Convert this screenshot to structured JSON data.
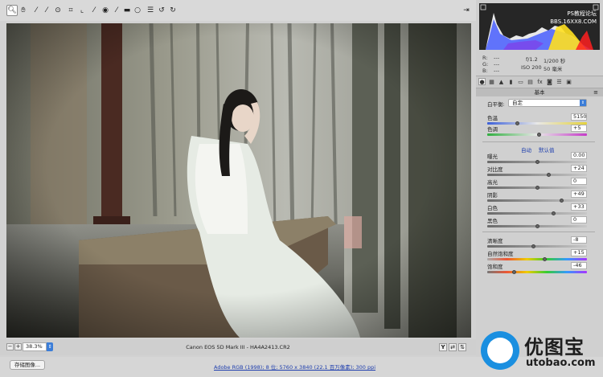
{
  "toolbar": {
    "tools": [
      {
        "name": "zoom-icon",
        "glyph": "🔍︎"
      },
      {
        "name": "hand-icon",
        "glyph": "✋︎"
      },
      {
        "name": "white-balance-icon",
        "glyph": "⁄"
      },
      {
        "name": "color-sampler-icon",
        "glyph": "⁄"
      },
      {
        "name": "target-adjust-icon",
        "glyph": "⊙"
      },
      {
        "name": "crop-icon",
        "glyph": "⌗"
      },
      {
        "name": "straighten-icon",
        "glyph": "⌞"
      },
      {
        "name": "spot-removal-icon",
        "glyph": "⁄"
      },
      {
        "name": "red-eye-icon",
        "glyph": "◉"
      },
      {
        "name": "adjustment-brush-icon",
        "glyph": "⁄"
      },
      {
        "name": "graduated-filter-icon",
        "glyph": "▬"
      },
      {
        "name": "radial-filter-icon",
        "glyph": "○"
      },
      {
        "name": "preferences-icon",
        "glyph": "☰"
      },
      {
        "name": "rotate-ccw-icon",
        "glyph": "↺"
      },
      {
        "name": "rotate-cw-icon",
        "glyph": "↻"
      }
    ],
    "export_glyph": "⇥"
  },
  "zoom": {
    "minus": "−",
    "plus": "+",
    "value": "38.3%",
    "arrow": "⇕"
  },
  "filename": "Canon EOS 5D Mark III -   HA4A2413.CR2",
  "statusbar": {
    "save_label": "存储图像...",
    "workflow": "Adobe RGB (1998); 8 位;   5760 x 3840 (22.1 百万像素); 300 ppi"
  },
  "histogram": {
    "watermark_line1": "PS教程论坛",
    "watermark_line2": "BBS.16XX8.COM"
  },
  "info": {
    "r_label": "R:",
    "g_label": "G:",
    "b_label": "B:",
    "r_value": "---",
    "g_value": "---",
    "b_value": "---",
    "aperture": "f/1.2",
    "shutter": "1/200 秒",
    "iso": "ISO 200",
    "focal": "50 毫米"
  },
  "panel": {
    "section_title": "基本",
    "section_menu": "≡",
    "wb_label": "白平衡:",
    "wb_value": "自定",
    "auto_label": "自动",
    "default_label": "默认值",
    "sliders": [
      {
        "name": "temperature",
        "label": "色温",
        "value": "5150",
        "fraction": 0.3
      },
      {
        "name": "tint",
        "label": "色调",
        "value": "+5",
        "fraction": 0.52
      },
      {
        "name": "exposure",
        "label": "曝光",
        "value": "0.00",
        "fraction": 0.5
      },
      {
        "name": "contrast",
        "label": "对比度",
        "value": "+24",
        "fraction": 0.62
      },
      {
        "name": "highlights",
        "label": "高光",
        "value": "0",
        "fraction": 0.5
      },
      {
        "name": "shadows",
        "label": "阴影",
        "value": "+49",
        "fraction": 0.745
      },
      {
        "name": "whites",
        "label": "白色",
        "value": "+33",
        "fraction": 0.665
      },
      {
        "name": "blacks",
        "label": "黑色",
        "value": "0",
        "fraction": 0.5
      },
      {
        "name": "clarity",
        "label": "清晰度",
        "value": "-8",
        "fraction": 0.46
      },
      {
        "name": "vibrance",
        "label": "自然饱和度",
        "value": "+15",
        "fraction": 0.575
      },
      {
        "name": "saturation",
        "label": "饱和度",
        "value": "-46",
        "fraction": 0.27
      }
    ]
  },
  "logo": {
    "cn": "优图宝",
    "en": "utobao.com"
  },
  "colors": {
    "accent": "#3b7dd8",
    "link": "#1f3fae",
    "logo_blue": "#1a8fe0"
  }
}
